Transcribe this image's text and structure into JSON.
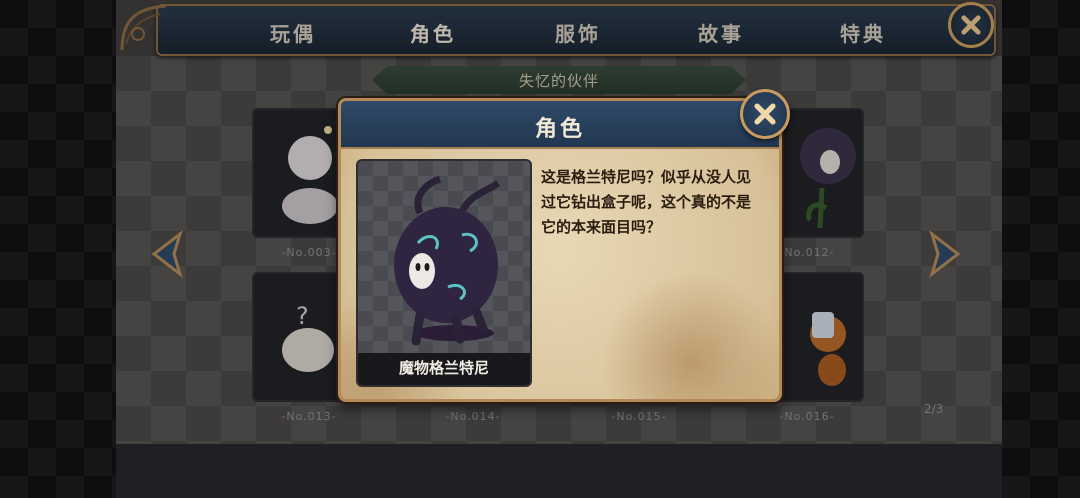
{
  "tabs": [
    "玩偶",
    "角色",
    "服饰",
    "故事",
    "特典"
  ],
  "active_tab": "角色",
  "subtitle": "失忆的伙伴",
  "cards": [
    {
      "num": "-No.003-"
    },
    {
      "num": "-No.012-"
    },
    {
      "num": "-No.013-"
    },
    {
      "num": "-No.014-"
    },
    {
      "num": "-No.015-"
    },
    {
      "num": "-No.016-"
    }
  ],
  "page_indicator": "2/3",
  "modal": {
    "title": "角色",
    "character_name": "魔物格兰特尼",
    "description": "这是格兰特尼吗？似乎从没人见过它钻出盒子呢，这个真的不是它的本来面目吗？"
  },
  "colors": {
    "frame_gold": "#c99b5e",
    "header_blue": "#2f4a68",
    "parchment": "#e8d8b5"
  },
  "icons": [
    "close-icon",
    "arrow-left-icon",
    "arrow-right-icon"
  ]
}
